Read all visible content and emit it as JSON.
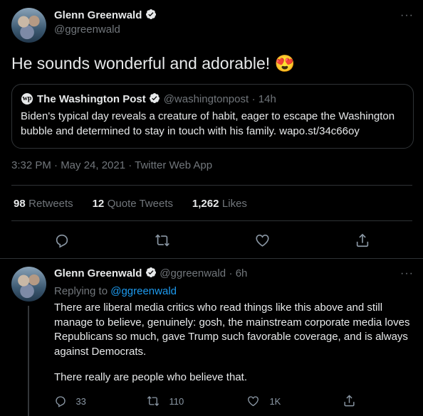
{
  "tweet": {
    "author_name": "Glenn Greenwald",
    "author_handle": "@ggreenwald",
    "text": "He sounds wonderful and adorable!",
    "emoji": "😍",
    "more_label": "···",
    "quoted": {
      "logo_text": "wp",
      "name": "The Washington Post",
      "handle": "@washingtonpost",
      "time": "· 14h",
      "text": "Biden's typical day reveals a creature of habit, eager to escape the Washington bubble and determined to stay in touch with his family. wapo.st/34c66oy"
    },
    "timestamp": "3:32 PM · May 24, 2021 · Twitter Web App",
    "stats": {
      "retweets_num": "98",
      "retweets_label": "Retweets",
      "quotes_num": "12",
      "quotes_label": "Quote Tweets",
      "likes_num": "1,262",
      "likes_label": "Likes"
    }
  },
  "reply": {
    "author_name": "Glenn Greenwald",
    "author_handle": "@ggreenwald",
    "time": "· 6h",
    "more_label": "···",
    "replying_prefix": "Replying to",
    "replying_handle": "@ggreenwald",
    "text_p1": "There are liberal media critics who read things like this above and still manage to believe, genuinely: gosh, the mainstream corporate media loves Republicans so much, gave Trump such favorable coverage, and is always against Democrats.",
    "text_p2": "There really are people who believe that.",
    "counts": {
      "replies": "33",
      "retweets": "110",
      "likes": "1K"
    }
  },
  "colors": {
    "background": "#000000",
    "link": "#1d9bf0",
    "verified": "#ffffff"
  }
}
